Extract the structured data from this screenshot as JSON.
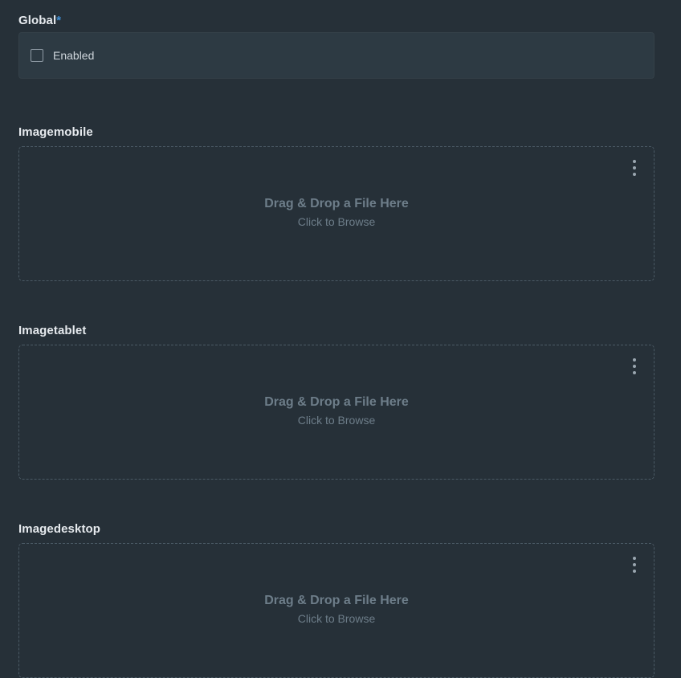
{
  "global": {
    "label": "Global",
    "required_marker": "*",
    "checkbox_label": "Enabled",
    "checked": false
  },
  "uploads": [
    {
      "label": "Imagemobile",
      "drop_text": "Drag & Drop a File Here",
      "browse_text": "Click to Browse"
    },
    {
      "label": "Imagetablet",
      "drop_text": "Drag & Drop a File Here",
      "browse_text": "Click to Browse"
    },
    {
      "label": "Imagedesktop",
      "drop_text": "Drag & Drop a File Here",
      "browse_text": "Click to Browse"
    }
  ],
  "icons": {
    "menu": "more-vertical-icon"
  }
}
